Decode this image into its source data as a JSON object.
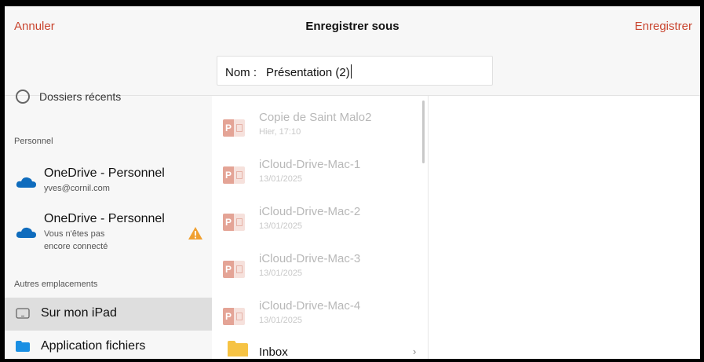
{
  "header": {
    "cancel_label": "Annuler",
    "title": "Enregistrer sous",
    "save_label": "Enregistrer"
  },
  "name_field": {
    "label": "Nom :",
    "value": "Présentation (2)"
  },
  "sidebar": {
    "recent_label": "Dossiers récents",
    "personal_section": "Personnel",
    "accounts": [
      {
        "name": "OneDrive - Personnel",
        "sub1": "yves@cornil.com",
        "sub2": "",
        "icon": "onedrive-cloud-icon"
      },
      {
        "name": "OneDrive - Personnel",
        "sub1": "Vous n'êtes pas",
        "sub2": "encore connecté",
        "icon": "onedrive-cloud-icon",
        "warning": true
      }
    ],
    "other_section": "Autres emplacements",
    "locations": [
      {
        "label": "Sur mon iPad",
        "icon": "ipad-icon",
        "selected": true
      },
      {
        "label": "Application fichiers",
        "icon": "folder-icon",
        "selected": false
      }
    ]
  },
  "files": [
    {
      "name": "Copie de Saint Malo2",
      "date": "Hier, 17:10",
      "icon": "powerpoint-file-icon"
    },
    {
      "name": "iCloud-Drive-Mac-1",
      "date": "13/01/2025",
      "icon": "powerpoint-file-icon"
    },
    {
      "name": "iCloud-Drive-Mac-2",
      "date": "13/01/2025",
      "icon": "powerpoint-file-icon"
    },
    {
      "name": "iCloud-Drive-Mac-3",
      "date": "13/01/2025",
      "icon": "powerpoint-file-icon"
    },
    {
      "name": "iCloud-Drive-Mac-4",
      "date": "13/01/2025",
      "icon": "powerpoint-file-icon"
    }
  ],
  "inbox": {
    "name": "Inbox",
    "icon": "folder-icon"
  },
  "colors": {
    "accent": "#c9452f",
    "onedrive": "#0f6cbd",
    "folder": "#f6c344",
    "warning": "#f0a030"
  }
}
